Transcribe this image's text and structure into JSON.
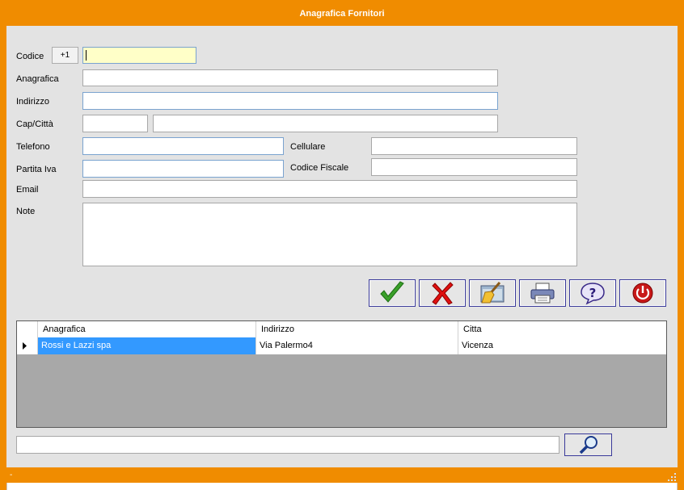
{
  "window": {
    "title": "Anagrafica Fornitori",
    "status_text": "-"
  },
  "form": {
    "codice": {
      "label": "Codice",
      "increment_label": "+1",
      "value": ""
    },
    "anagrafica": {
      "label": "Anagrafica",
      "value": ""
    },
    "indirizzo": {
      "label": "Indirizzo",
      "value": ""
    },
    "cap_citta": {
      "label": "Cap/Città",
      "cap_value": "",
      "citta_value": ""
    },
    "telefono": {
      "label": "Telefono",
      "value": ""
    },
    "cellulare": {
      "label": "Cellulare",
      "value": ""
    },
    "partita_iva": {
      "label": "Partita Iva",
      "value": ""
    },
    "codice_fiscale": {
      "label": "Codice Fiscale",
      "value": ""
    },
    "email": {
      "label": "Email",
      "value": ""
    },
    "note": {
      "label": "Note",
      "value": ""
    }
  },
  "toolbar": {
    "buttons": [
      {
        "icon": "checkmark-icon",
        "color": "#3aa02a"
      },
      {
        "icon": "x-cross-icon",
        "color": "#e01010"
      },
      {
        "icon": "broom-clear-icon",
        "color": "#e0a020"
      },
      {
        "icon": "printer-icon",
        "color": "#3a4a8a"
      },
      {
        "icon": "help-question-icon",
        "color": "#5a3aa0"
      },
      {
        "icon": "power-exit-icon",
        "color": "#c81818"
      }
    ]
  },
  "grid": {
    "columns": [
      "Anagrafica",
      "Indirizzo",
      "Citta"
    ],
    "rows": [
      {
        "anagrafica": "Rossi e Lazzi spa",
        "indirizzo": "Via Palermo4",
        "citta": "Vicenza"
      }
    ]
  },
  "search": {
    "value": "",
    "icon": "magnifier-icon"
  },
  "colors": {
    "accent": "#f08c00",
    "client_bg": "#e3e3e3",
    "selection": "#3399ff",
    "grid_empty": "#a8a8a8"
  }
}
